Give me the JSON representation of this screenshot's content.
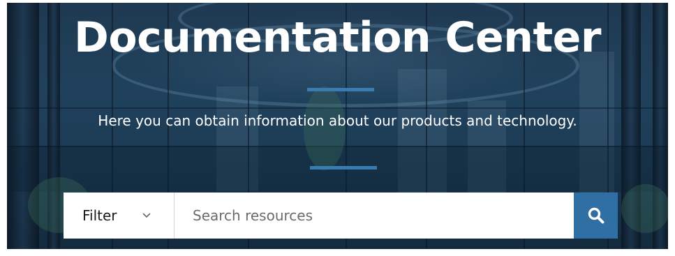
{
  "hero": {
    "title": "Documentation Center",
    "subtitle": "Here you can obtain information about our products and technology."
  },
  "search": {
    "filter_label": "Filter",
    "placeholder": "Search resources",
    "value": ""
  },
  "icons": {
    "filter_chevron": "chevron-down-icon",
    "search": "search-icon"
  },
  "colors": {
    "accent": "#3b7cb0",
    "search_button": "#2f6fa3",
    "hero_overlay": "#1f3a52"
  }
}
